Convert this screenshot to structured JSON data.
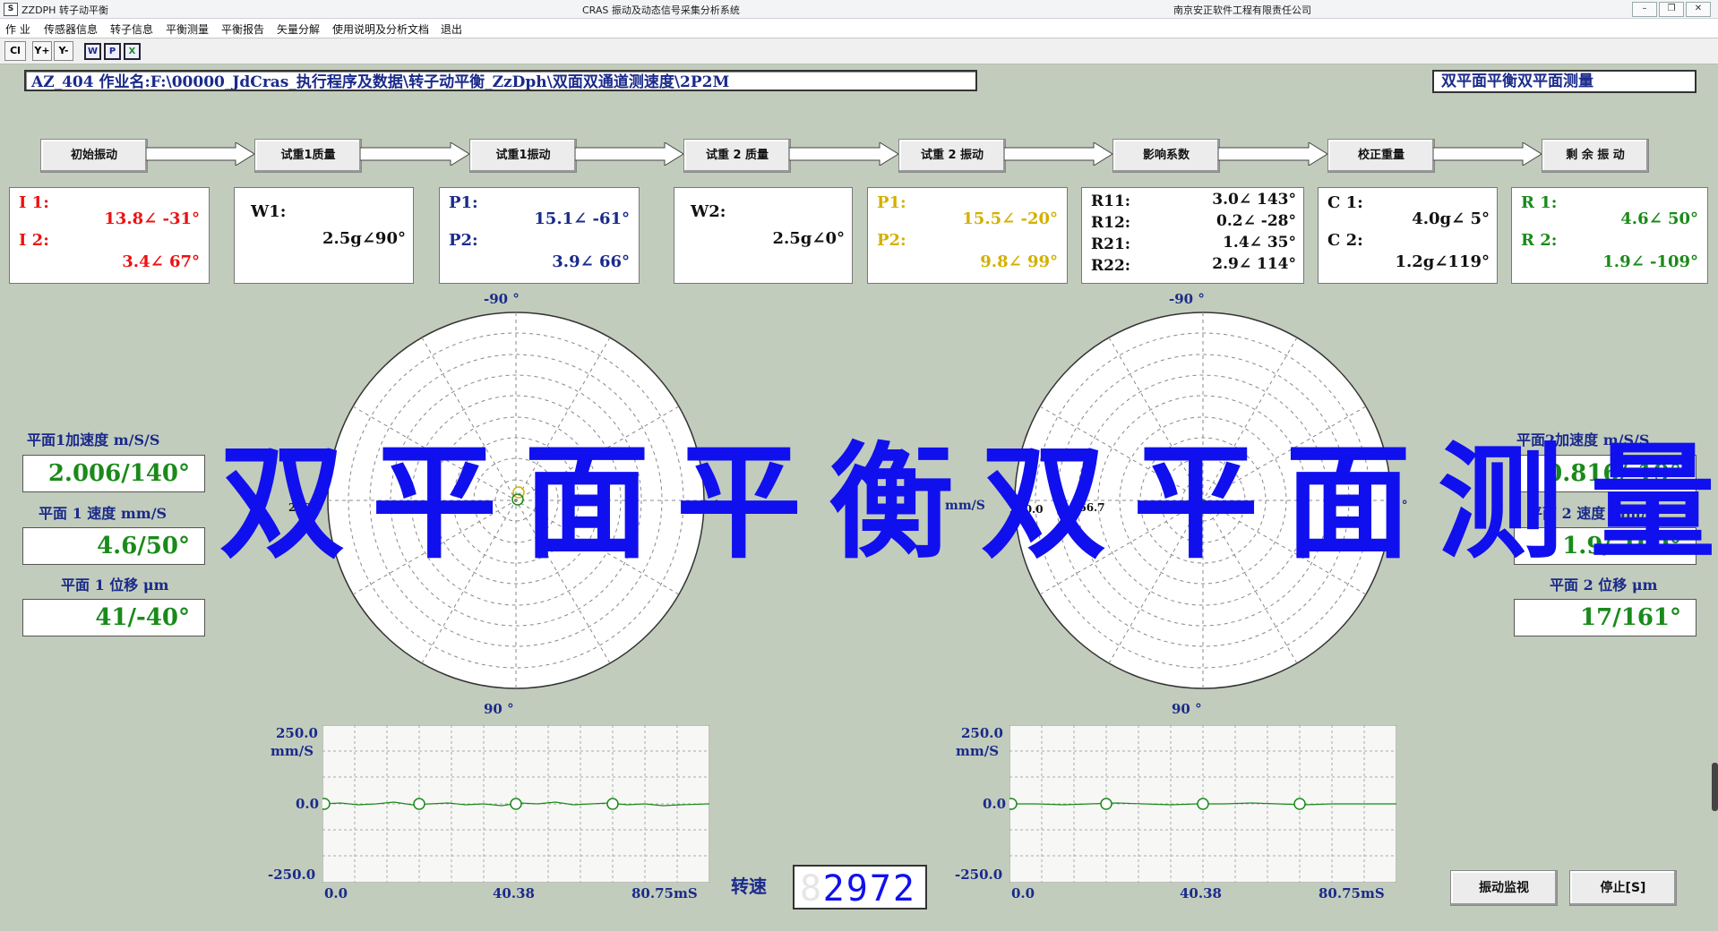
{
  "window": {
    "app_title": "ZZDPH 转子动平衡",
    "center_title": "CRAS 振动及动态信号采集分析系统",
    "company": "南京安正软件工程有限责任公司",
    "icon_letter": "S"
  },
  "menu": [
    "作 业",
    "传感器信息",
    "转子信息",
    "平衡测量",
    "平衡报告",
    "矢量分解",
    "使用说明及分析文档",
    "退出"
  ],
  "toolbar": {
    "cl": "Cl",
    "y_plus": "Y+",
    "y_minus": "Y-",
    "w": "W",
    "p": "P",
    "x": "X"
  },
  "job_path": "AZ_404 作业名:F:\\00000_JdCras_执行程序及数据\\转子动平衡_ZzDph\\双面双通道测速度\\2P2M",
  "mode_label": "双平面平衡双平面测量",
  "steps": [
    "初始振动",
    "试重1质量",
    "试重1振动",
    "试重 2 质量",
    "试重 2 振动",
    "影响系数",
    "校正重量",
    "剩 余 振 动"
  ],
  "cards": {
    "initial": {
      "l1": "I 1:",
      "v1": "13.8∠ -31°",
      "l2": "I 2:",
      "v2": "3.4∠ 67°"
    },
    "w1": {
      "label": "W1:",
      "value": "2.5g∠90°"
    },
    "p_trial1": {
      "l1": "P1:",
      "v1": "15.1∠ -61°",
      "l2": "P2:",
      "v2": "3.9∠ 66°"
    },
    "w2": {
      "label": "W2:",
      "value": "2.5g∠0°"
    },
    "p_trial2": {
      "l1": "P1:",
      "v1": "15.5∠ -20°",
      "l2": "P2:",
      "v2": "9.8∠ 99°"
    },
    "influence": {
      "l1": "R11:",
      "v1": "3.0∠ 143°",
      "l2": "R12:",
      "v2": "0.2∠ -28°",
      "l3": "R21:",
      "v3": "1.4∠ 35°",
      "l4": "R22:",
      "v4": "2.9∠ 114°"
    },
    "correction": {
      "l1": "C 1:",
      "v1": "4.0g∠  5°",
      "l2": "C 2:",
      "v2": "1.2g∠119°"
    },
    "residual": {
      "l1": "R 1:",
      "v1": "4.6∠ 50°",
      "l2": "R 2:",
      "v2": "1.9∠ -109°"
    }
  },
  "colors": {
    "initial": "#ee1111",
    "p_trial2": "#d4b000",
    "residual": "#1a8a1a",
    "navy": "#1a2a8a"
  },
  "polar": {
    "top_label": "-90 °",
    "bottom_label": "90 °",
    "right_label": "0 °",
    "unit": "mm/S",
    "scale_labels": [
      "250.0",
      "166.7",
      "83.3"
    ]
  },
  "plane1": {
    "accel_title": "平面1加速度 m/S/S",
    "accel_value": "2.006/140°",
    "vel_title": "平面 1 速度 mm/S",
    "vel_value": "4.6/50°",
    "disp_title": "平面 1 位移 μm",
    "disp_value": "41/-40°"
  },
  "plane2": {
    "accel_title": "平面2加速度 m/S/S",
    "accel_value": "0.816/-19°",
    "vel_title": "平面 2 速度 mm/S",
    "vel_value": "1.9/-109°",
    "disp_title": "平面 2 位移 μm",
    "disp_value": "17/161°"
  },
  "waveform": {
    "y_max": "250.0",
    "y_unit": "mm/S",
    "y_zero": "0.0",
    "y_min": "-250.0",
    "x_ticks": [
      "0.0",
      "40.38",
      "80.75mS"
    ]
  },
  "overlay_text": "双平面平衡双平面测量",
  "speed": {
    "label": "转速",
    "value": "2972",
    "ghost": "8"
  },
  "buttons": {
    "monitor": "振动监视",
    "stop": "停止[S]"
  }
}
